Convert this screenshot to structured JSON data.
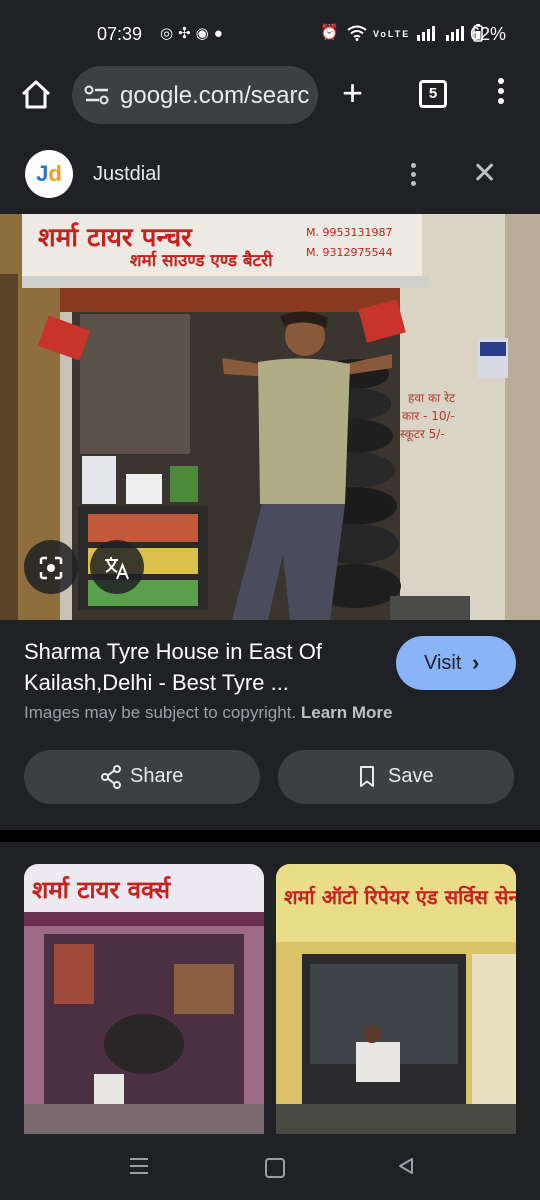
{
  "status_bar": {
    "time": "07:39",
    "notif_icons": [
      "whatsapp-icon",
      "pinwheel-icon",
      "messenger-icon",
      "chat-icon"
    ],
    "battery": "62%"
  },
  "toolbar": {
    "url": "google.com/search",
    "tab_count": "5"
  },
  "source": {
    "name": "Justdial",
    "logo_j": "J",
    "logo_d": "d"
  },
  "signboard": {
    "line1": "शर्मा टायर पन्चर",
    "line2": "शर्मा साउण्ड एण्ड बैटरी",
    "phone1": "M. 9953131987",
    "phone2": "M. 9312975544"
  },
  "wall_text": {
    "line1": "हवा का रेट",
    "line2": "कार - 10/-",
    "line3": "स्कूटर 5/-"
  },
  "result": {
    "title": "Sharma Tyre House in East Of Kailash,Delhi - Best Tyre ...",
    "visit_label": "Visit",
    "copyright_text": "Images may be subject to copyright.",
    "learn_more": "Learn More",
    "share_label": "Share",
    "save_label": "Save"
  },
  "related": [
    {
      "sign": "शर्मा टायर वर्क्स"
    },
    {
      "sign": "शर्मा ऑटो रिपेयर एंड सर्विस सेन्टर"
    }
  ],
  "colors": {
    "accent_blue": "#8ab4f8",
    "sheet_bg": "#202124",
    "sign_red": "#c8201c"
  }
}
